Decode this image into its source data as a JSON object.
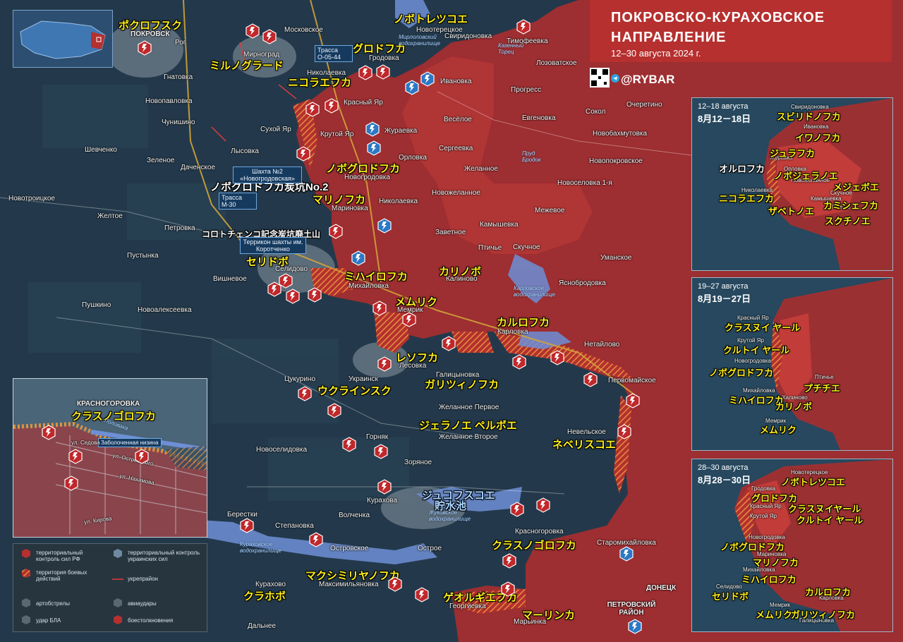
{
  "header": {
    "title_line1": "ПОКРОВСКО-КУРАХОВСКОЕ",
    "title_line2": "НАПРАВЛЕНИЕ",
    "subtitle": "12–30 августа 2024 г.",
    "brand": "@RYBAR"
  },
  "colors": {
    "russian_control": "#b5302f",
    "contested": "#d9893a",
    "ukrainian_control": "#1e3446",
    "water": "#6e8fd6",
    "yellow_label": "#ffef1a"
  },
  "towns": [
    "Московское",
    "Новотерецкое",
    "Свиридоновка",
    "Тимофеевка",
    "ПОКРОВСК",
    "Рог",
    "Мирноград",
    "Гродовка",
    "Гнатовка",
    "Николаевка",
    "Ивановка",
    "Лозоватское",
    "Прогресс",
    "Новопавловка",
    "Красный Яр",
    "Евгеновка",
    "Сокол",
    "Очеретино",
    "Чунишино",
    "Сухой Яр",
    "Жураевка",
    "Весёлое",
    "Новобахмутовка",
    "Крутой Яр",
    "Шевченко",
    "Лысовка",
    "Сергеевка",
    "Орловка",
    "Зеленое",
    "Даченское",
    "Новогродовка",
    "Желанное",
    "Новопокровское",
    "Новоселовка 1-я",
    "Новотроицкое",
    "Новожеланное",
    "Межевое",
    "Желтое",
    "Николаевка",
    "Мариновка",
    "Петровка",
    "Камышевка",
    "Заветное",
    "Скучное",
    "Пустынка",
    "Птичье",
    "Уманское",
    "Селидово",
    "Вишневое",
    "Михайловка",
    "Калиново",
    "Яснобродовка",
    "Пушкино",
    "Новоалексеевка",
    "Мемрик",
    "Карловка",
    "Нетайлово",
    "Лесовка",
    "Цукурино",
    "Украинск",
    "Галицыновка",
    "Первомайское",
    "Желанное Первое",
    "Невельское",
    "Желанное Второе",
    "Горняк",
    "Новоселидовка",
    "Зоряное",
    "Курахова",
    "Волченка",
    "Берестки",
    "Степановка",
    "Красногоровка",
    "Островское",
    "Острое",
    "Старомихайловка",
    "Курахово",
    "Максимильяновка",
    "ДОНЕЦК",
    "Георгиевка",
    "Марьинка",
    "Дальнее"
  ],
  "jp_labels": [
    "ポクロフスク",
    "ノボトレツコエ",
    "グロドフカ",
    "ミルノグラード",
    "ニコラエフカ",
    "ノボグロドフカ",
    "ノボグロドフカ炭坑No.2",
    "マリノフカ",
    "コロトチェンコ記念炭坑廃土山",
    "セリドボ",
    "ミハイロフカ",
    "カリノボ",
    "メムリク",
    "カルロフカ",
    "レソフカ",
    "ガリツィノフカ",
    "ウクラインスク",
    "ジェラノエ ペルボエ",
    "ネベリスコエ",
    "ジュコフスコエ",
    "貯水池",
    "クラスノゴロフカ",
    "マクシミリヤノフカ",
    "ゲオルギエフカ",
    "マーリンカ",
    "クラホボ"
  ],
  "map_tags": {
    "highway1": "Трасса О-05-44",
    "highway2": "Трасса М-30",
    "mine": "Шахта №2 «Новогродовская»",
    "terrikon": "Террикон шахты им. Коротченко",
    "reservoir1": "Мирлоловский водохранилище",
    "reservoir2": "Жуковское водохранилище",
    "reservoir3": "Карловское водохранилище",
    "reservoir4": "Кураховское водохранилище",
    "river1": "Казенный Торец",
    "river2": "Пруд Бродок",
    "district": "ПЕТРОВСКИЙ РАЙОН"
  },
  "inset": {
    "town": "КРАСНОГОРОВКА",
    "town_jp": "クラスノゴロフカ",
    "lowland": "Заболоченная низина",
    "streets": [
      "ул. Седова",
      "ул. Островского",
      "ул. Нахимова",
      "ул. Кирова"
    ],
    "river": "Лоливака"
  },
  "panels": [
    {
      "title": "12–18 августа",
      "date": "8月12－18日",
      "places": [
        "Свиридоновка",
        "Ивановка",
        "Журавка",
        "Орловка",
        "Новожеланное",
        "Николаевка",
        "Камышевка",
        "Скучное",
        "Птичье"
      ],
      "jp": [
        "スビリドノフカ",
        "イワノフカ",
        "ジュラフカ",
        "オルロフカ",
        "ノボジェラノエ",
        "ニコラエフカ",
        "メジェボエ",
        "カミシェフカ",
        "ザベトノエ",
        "スクチノエ"
      ]
    },
    {
      "title": "19–27 августа",
      "date": "8月19－27日",
      "places": [
        "Красный Яр",
        "Крутой Яр",
        "Новогродовка",
        "Птичье",
        "Михайловка",
        "Калиново",
        "Мемрик"
      ],
      "jp": [
        "クラスヌイ ヤール",
        "クルトイ ヤール",
        "ノボグロドフカ",
        "プチチエ",
        "ミハイロフカ",
        "カリノボ",
        "メムリク"
      ]
    },
    {
      "title": "28–30 августа",
      "date": "8月28－30日",
      "places": [
        "Новотерецкое",
        "Гродовка",
        "Красный Яр",
        "Крутой Яр",
        "Новогродовка",
        "Мариновка",
        "Михайловка",
        "Селидово",
        "Карловка",
        "Мемрик",
        "Галицыновка"
      ],
      "jp": [
        "ノボトレツコエ",
        "グロドフカ",
        "クラスヌイヤール",
        "クルトイ ヤール",
        "ノボグロドフカ",
        "マリノフカ",
        "ミハイロフカ",
        "セリドボ",
        "カルロフカ",
        "メムリク",
        "ガリツィノフカ"
      ]
    }
  ],
  "legend": {
    "ru": "территориальный контроль сил РФ",
    "contested": "территория боевых действий",
    "ua": "территориальный контроль украинских сил",
    "fortified": "укрепрайон",
    "artillery": "артобстрелы",
    "airstrikes": "авиаудары",
    "drone": "удар БЛА",
    "clashes": "боестолкновения"
  }
}
